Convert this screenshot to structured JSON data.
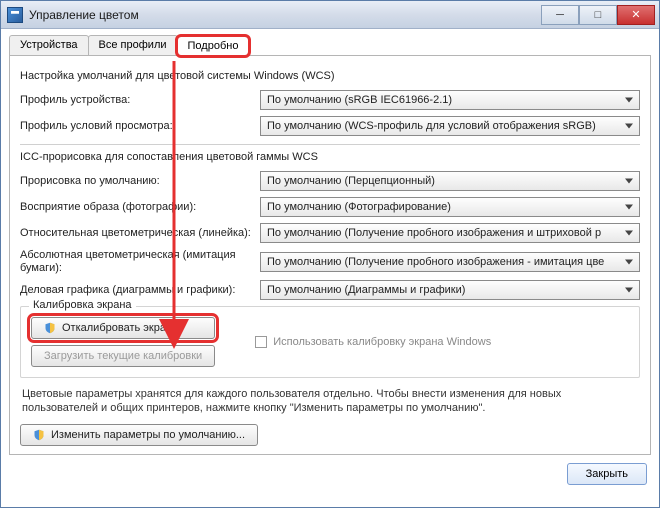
{
  "window": {
    "title": "Управление цветом"
  },
  "tabs": {
    "devices": "Устройства",
    "allprofiles": "Все профили",
    "details": "Подробно"
  },
  "wcs": {
    "header": "Настройка умолчаний для цветовой системы Windows (WCS)",
    "device_profile_label": "Профиль устройства:",
    "device_profile_value": "По умолчанию (sRGB IEC61966-2.1)",
    "viewing_cond_label": "Профиль условий просмотра:",
    "viewing_cond_value": "По умолчанию (WCS-профиль для условий отображения sRGB)"
  },
  "icc": {
    "header": "ICC-прорисовка для сопоставления цветовой гаммы WCS",
    "default_rendering_label": "Прорисовка по умолчанию:",
    "default_rendering_value": "По умолчанию (Перцепционный)",
    "photo_label": "Восприятие образа (фотографии):",
    "photo_value": "По умолчанию (Фотографирование)",
    "relcolor_label": "Относительная цветометрическая\n(линейка):",
    "relcolor_value": "По умолчанию (Получение пробного изображения и штриховой р",
    "abscolor_label": "Абсолютная цветометрическая\n(имитация бумаги):",
    "abscolor_value": "По умолчанию (Получение пробного изображения - имитация цве",
    "business_label": "Деловая графика (диаграммы и\nграфики):",
    "business_value": "По умолчанию (Диаграммы и графики)"
  },
  "calib": {
    "group_title": "Калибровка экрана",
    "calibrate_btn": "Откалибровать экран",
    "load_current_btn": "Загрузить текущие калибровки",
    "use_windows_calib": "Использовать калибровку экрана Windows"
  },
  "hint": "Цветовые параметры хранятся для каждого пользователя отдельно. Чтобы внести изменения для новых пользователей и общих принтеров, нажмите кнопку \"Изменить параметры по умолчанию\".",
  "change_defaults_btn": "Изменить параметры по умолчанию...",
  "close_btn": "Закрыть"
}
